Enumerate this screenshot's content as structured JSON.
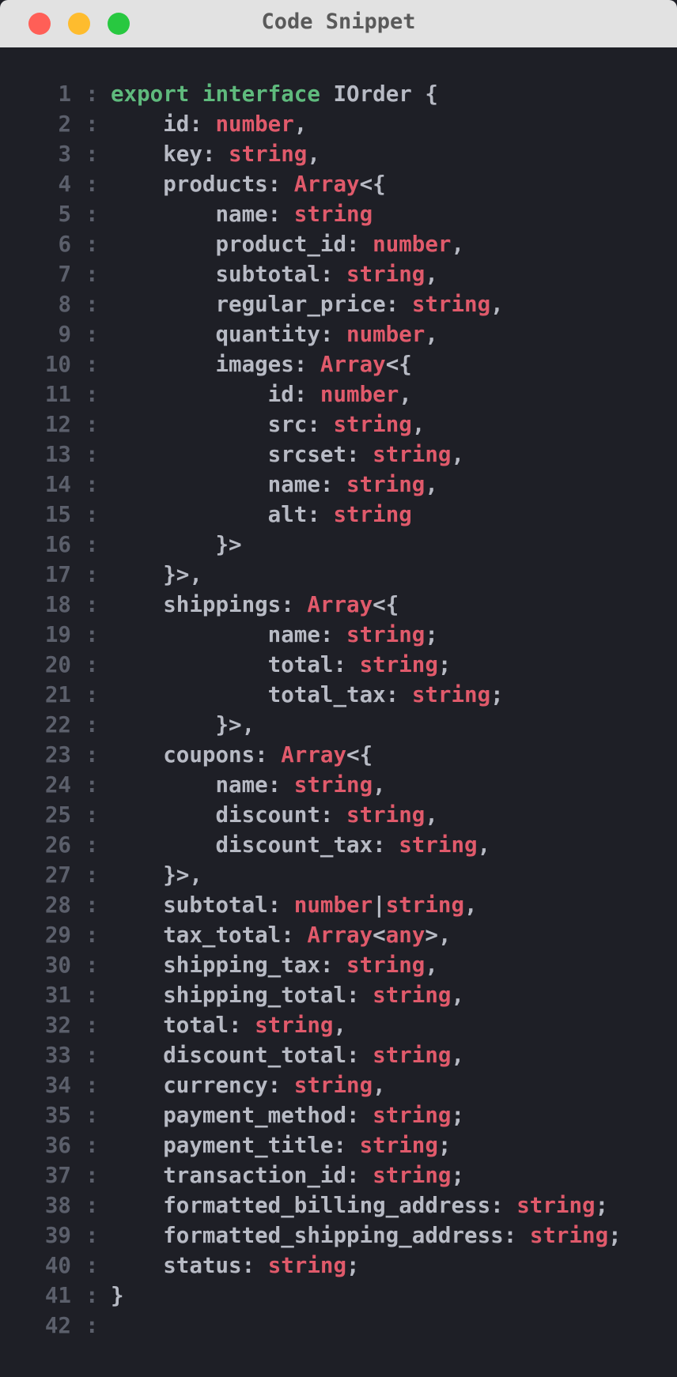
{
  "window": {
    "title": "Code Snippet",
    "colors": {
      "close": "#ff5f57",
      "minimize": "#febc2e",
      "zoom": "#28c840",
      "background": "#1e1f26",
      "keyword": "#5fba7d",
      "type": "#e05a6b",
      "text": "#b7bac4"
    }
  },
  "code": {
    "lines": [
      [
        [
          "kw",
          "export interface"
        ],
        [
          "id",
          " IOrder {"
        ]
      ],
      [
        [
          "id",
          "    id: "
        ],
        [
          "type",
          "number"
        ],
        [
          "punc",
          ","
        ]
      ],
      [
        [
          "id",
          "    key: "
        ],
        [
          "type",
          "string"
        ],
        [
          "punc",
          ","
        ]
      ],
      [
        [
          "id",
          "    products: "
        ],
        [
          "type",
          "Array"
        ],
        [
          "punc",
          "<{"
        ]
      ],
      [
        [
          "id",
          "        name: "
        ],
        [
          "type",
          "string"
        ]
      ],
      [
        [
          "id",
          "        product_id: "
        ],
        [
          "type",
          "number"
        ],
        [
          "punc",
          ","
        ]
      ],
      [
        [
          "id",
          "        subtotal: "
        ],
        [
          "type",
          "string"
        ],
        [
          "punc",
          ","
        ]
      ],
      [
        [
          "id",
          "        regular_price: "
        ],
        [
          "type",
          "string"
        ],
        [
          "punc",
          ","
        ]
      ],
      [
        [
          "id",
          "        quantity: "
        ],
        [
          "type",
          "number"
        ],
        [
          "punc",
          ","
        ]
      ],
      [
        [
          "id",
          "        images: "
        ],
        [
          "type",
          "Array"
        ],
        [
          "punc",
          "<{"
        ]
      ],
      [
        [
          "id",
          "            id: "
        ],
        [
          "type",
          "number"
        ],
        [
          "punc",
          ","
        ]
      ],
      [
        [
          "id",
          "            src: "
        ],
        [
          "type",
          "string"
        ],
        [
          "punc",
          ","
        ]
      ],
      [
        [
          "id",
          "            srcset: "
        ],
        [
          "type",
          "string"
        ],
        [
          "punc",
          ","
        ]
      ],
      [
        [
          "id",
          "            name: "
        ],
        [
          "type",
          "string"
        ],
        [
          "punc",
          ","
        ]
      ],
      [
        [
          "id",
          "            alt: "
        ],
        [
          "type",
          "string"
        ]
      ],
      [
        [
          "punc",
          "        }>"
        ]
      ],
      [
        [
          "punc",
          "    }>,"
        ]
      ],
      [
        [
          "id",
          "    shippings: "
        ],
        [
          "type",
          "Array"
        ],
        [
          "punc",
          "<{"
        ]
      ],
      [
        [
          "id",
          "            name: "
        ],
        [
          "type",
          "string"
        ],
        [
          "punc",
          ";"
        ]
      ],
      [
        [
          "id",
          "            total: "
        ],
        [
          "type",
          "string"
        ],
        [
          "punc",
          ";"
        ]
      ],
      [
        [
          "id",
          "            total_tax: "
        ],
        [
          "type",
          "string"
        ],
        [
          "punc",
          ";"
        ]
      ],
      [
        [
          "punc",
          "        }>,"
        ]
      ],
      [
        [
          "id",
          "    coupons: "
        ],
        [
          "type",
          "Array"
        ],
        [
          "punc",
          "<{"
        ]
      ],
      [
        [
          "id",
          "        name: "
        ],
        [
          "type",
          "string"
        ],
        [
          "punc",
          ","
        ]
      ],
      [
        [
          "id",
          "        discount: "
        ],
        [
          "type",
          "string"
        ],
        [
          "punc",
          ","
        ]
      ],
      [
        [
          "id",
          "        discount_tax: "
        ],
        [
          "type",
          "string"
        ],
        [
          "punc",
          ","
        ]
      ],
      [
        [
          "punc",
          "    }>,"
        ]
      ],
      [
        [
          "id",
          "    subtotal: "
        ],
        [
          "type",
          "number"
        ],
        [
          "punc",
          "|"
        ],
        [
          "type",
          "string"
        ],
        [
          "punc",
          ","
        ]
      ],
      [
        [
          "id",
          "    tax_total: "
        ],
        [
          "type",
          "Array"
        ],
        [
          "punc",
          "<"
        ],
        [
          "type",
          "any"
        ],
        [
          "punc",
          ">,"
        ]
      ],
      [
        [
          "id",
          "    shipping_tax: "
        ],
        [
          "type",
          "string"
        ],
        [
          "punc",
          ","
        ]
      ],
      [
        [
          "id",
          "    shipping_total: "
        ],
        [
          "type",
          "string"
        ],
        [
          "punc",
          ","
        ]
      ],
      [
        [
          "id",
          "    total: "
        ],
        [
          "type",
          "string"
        ],
        [
          "punc",
          ","
        ]
      ],
      [
        [
          "id",
          "    discount_total: "
        ],
        [
          "type",
          "string"
        ],
        [
          "punc",
          ","
        ]
      ],
      [
        [
          "id",
          "    currency: "
        ],
        [
          "type",
          "string"
        ],
        [
          "punc",
          ","
        ]
      ],
      [
        [
          "id",
          "    payment_method: "
        ],
        [
          "type",
          "string"
        ],
        [
          "punc",
          ";"
        ]
      ],
      [
        [
          "id",
          "    payment_title: "
        ],
        [
          "type",
          "string"
        ],
        [
          "punc",
          ";"
        ]
      ],
      [
        [
          "id",
          "    transaction_id: "
        ],
        [
          "type",
          "string"
        ],
        [
          "punc",
          ";"
        ]
      ],
      [
        [
          "id",
          "    formatted_billing_address: "
        ],
        [
          "type",
          "string"
        ],
        [
          "punc",
          ";"
        ]
      ],
      [
        [
          "id",
          "    formatted_shipping_address: "
        ],
        [
          "type",
          "string"
        ],
        [
          "punc",
          ";"
        ]
      ],
      [
        [
          "id",
          "    status: "
        ],
        [
          "type",
          "string"
        ],
        [
          "punc",
          ";"
        ]
      ],
      [
        [
          "punc",
          "}"
        ]
      ],
      []
    ]
  }
}
